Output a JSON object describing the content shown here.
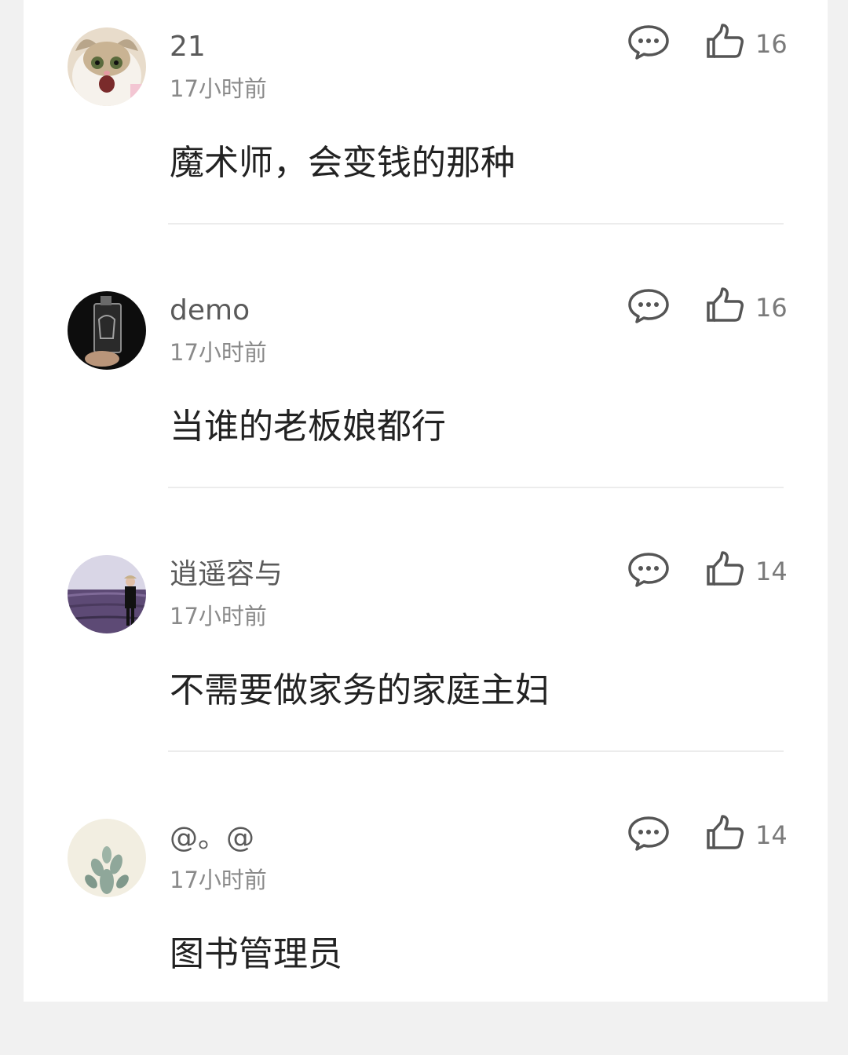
{
  "comments": [
    {
      "username": "21",
      "time": "17小时前",
      "content": "魔术师，会变钱的那种",
      "likes": "16",
      "avatar": "cat-avatar"
    },
    {
      "username": "demo",
      "time": "17小时前",
      "content": "当谁的老板娘都行",
      "likes": "16",
      "avatar": "bottle-avatar"
    },
    {
      "username": "逍遥容与",
      "time": "17小时前",
      "content": "不需要做家务的家庭主妇",
      "likes": "14",
      "avatar": "lavender-field-avatar"
    },
    {
      "username": "@。@",
      "time": "17小时前",
      "content": "图书管理员",
      "likes": "14",
      "avatar": "cactus-avatar"
    }
  ],
  "icons": {
    "reply": "comment-bubble-icon",
    "like": "thumbs-up-icon"
  },
  "colors": {
    "background": "#f1f1f1",
    "card": "#ffffff",
    "username": "#5a5a5a",
    "meta": "#8a8a8a",
    "content": "#222222"
  }
}
